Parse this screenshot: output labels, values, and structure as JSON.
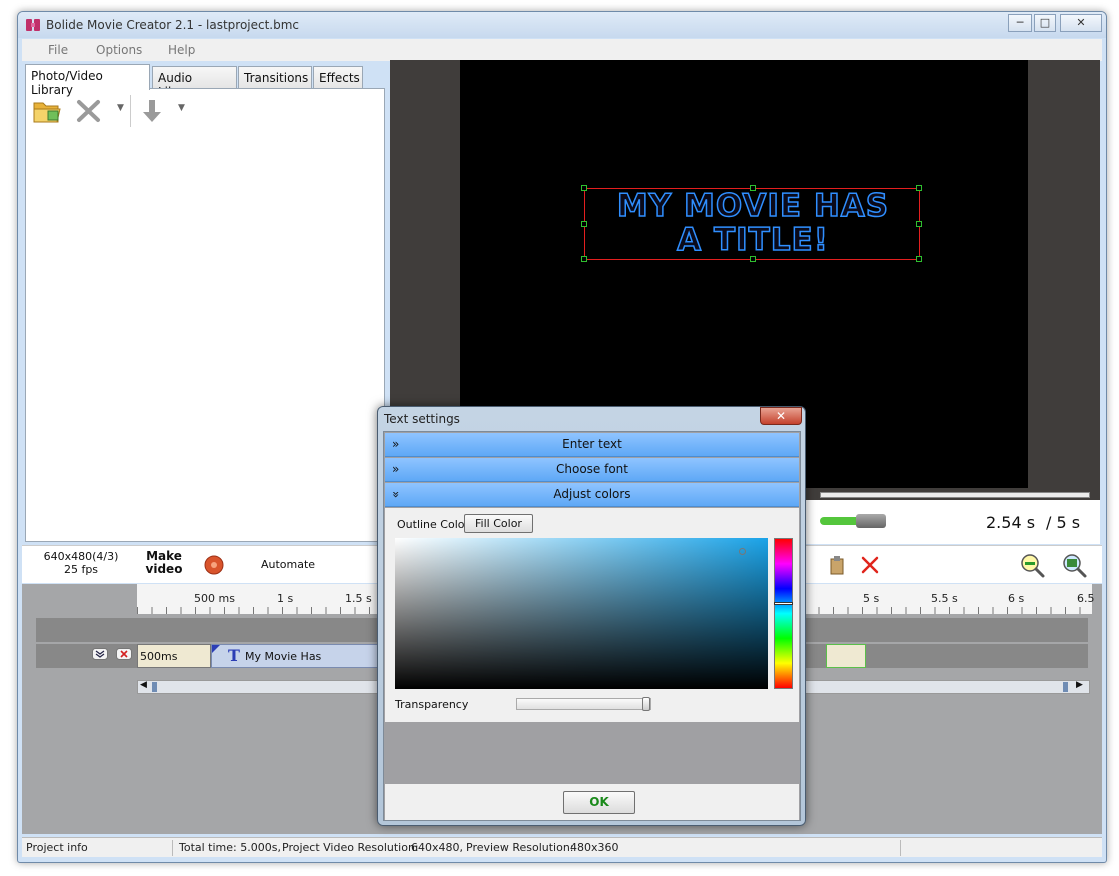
{
  "window": {
    "title": "Bolide Movie Creator 2.1 - lastproject.bmc",
    "minimize": "─",
    "maximize": "□",
    "close": "✕"
  },
  "menu": {
    "file": "File",
    "options": "Options",
    "help": "Help"
  },
  "tabs": {
    "photo_video": "Photo/Video Library",
    "audio": "Audio Library",
    "transitions": "Transitions",
    "effects": "Effects"
  },
  "preview": {
    "line1": "MY MOVIE HAS",
    "line2": "A TITLE!",
    "current_time": "2.54 s",
    "total_time": "/ 5 s"
  },
  "controls": {
    "resolution": "640x480(4/3)",
    "fps": "25 fps",
    "make_video_line1": "Make",
    "make_video_line2": "video",
    "automate": "Automate"
  },
  "timeline": {
    "ticks": [
      "500 ms",
      "1 s",
      "1.5 s",
      "5 s",
      "5.5 s",
      "6 s",
      "6.5"
    ],
    "clip_duration": "500ms",
    "text_clip_label": "My Movie Has"
  },
  "status": {
    "project_info": "Project info",
    "total_time": "Total time: 5.000s,",
    "video_res_label": "Project Video Resolution:",
    "video_res": "640x480,",
    "preview_res_label": "Preview Resolution:",
    "preview_res": "480x360"
  },
  "dialog": {
    "title": "Text settings",
    "close": "✕",
    "sections": {
      "enter_text": "Enter text",
      "choose_font": "Choose font",
      "adjust_colors": "Adjust colors"
    },
    "outline_color": "Outline Color",
    "fill_color": "Fill Color",
    "transparency": "Transparency",
    "ok": "OK"
  },
  "colors": {
    "accent_blue": "#5ea8f6",
    "title_blue": "#2f8fff",
    "selection_red": "#e31f1f",
    "ok_green": "#1a8a1a"
  }
}
